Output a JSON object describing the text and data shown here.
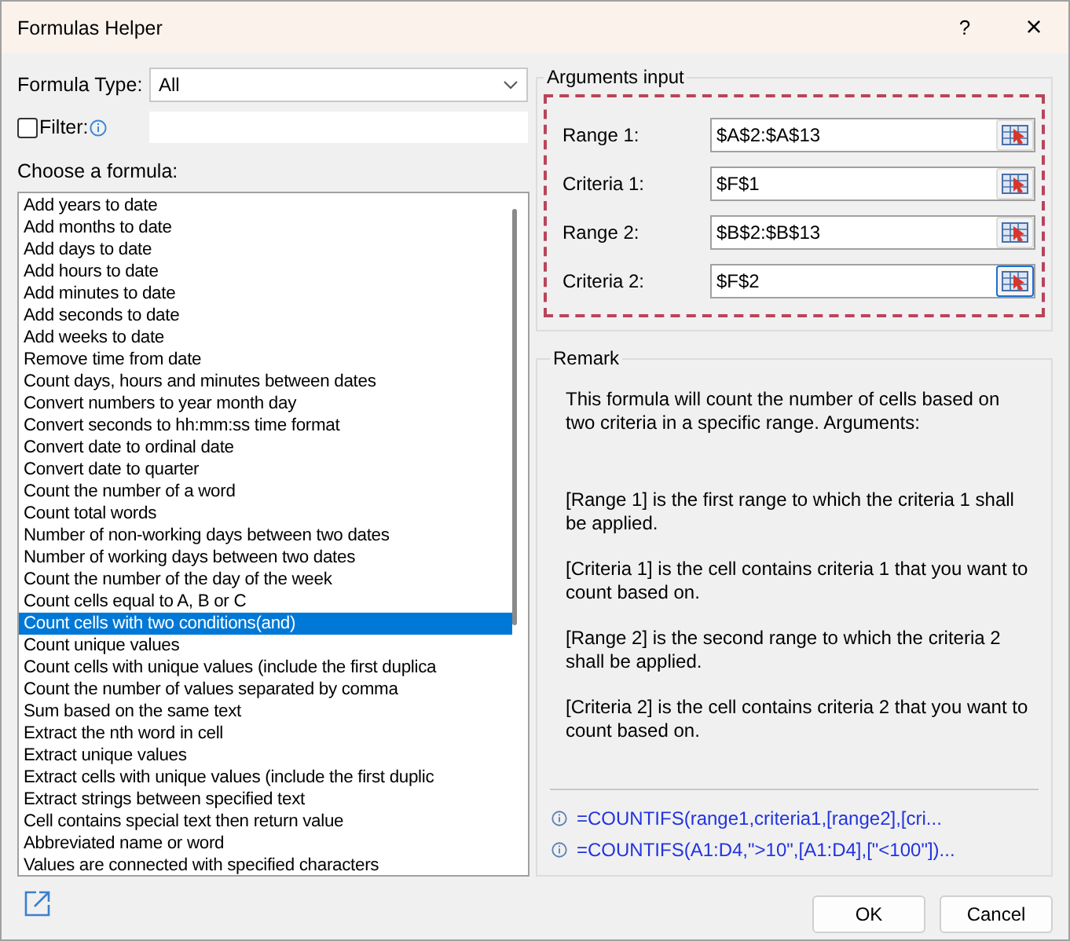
{
  "window": {
    "title": "Formulas Helper",
    "help": "?",
    "close": "×"
  },
  "formula_type": {
    "label": "Formula Type:",
    "value": "All"
  },
  "filter": {
    "label": "Filter:",
    "checked": false
  },
  "list": {
    "label": "Choose a formula:",
    "items": [
      {
        "text": "Add years to date",
        "selected": false
      },
      {
        "text": "Add months to date",
        "selected": false
      },
      {
        "text": "Add days to date",
        "selected": false
      },
      {
        "text": "Add hours to date",
        "selected": false
      },
      {
        "text": "Add minutes to date",
        "selected": false
      },
      {
        "text": "Add seconds to date",
        "selected": false
      },
      {
        "text": "Add weeks to date",
        "selected": false
      },
      {
        "text": "Remove time from date",
        "selected": false
      },
      {
        "text": "Count days, hours and minutes between dates",
        "selected": false
      },
      {
        "text": "Convert numbers to year month day",
        "selected": false
      },
      {
        "text": "Convert seconds to hh:mm:ss time format",
        "selected": false
      },
      {
        "text": "Convert date to ordinal date",
        "selected": false
      },
      {
        "text": "Convert date to quarter",
        "selected": false
      },
      {
        "text": "Count the number of a word",
        "selected": false
      },
      {
        "text": "Count total words",
        "selected": false
      },
      {
        "text": "Number of non-working days between two dates",
        "selected": false
      },
      {
        "text": "Number of working days between two dates",
        "selected": false
      },
      {
        "text": "Count the number of the day of the week",
        "selected": false
      },
      {
        "text": "Count cells equal to A, B or C",
        "selected": false
      },
      {
        "text": "Count cells with two conditions(and)",
        "selected": true
      },
      {
        "text": "Count unique values",
        "selected": false
      },
      {
        "text": "Count cells with unique values (include the first duplica",
        "selected": false
      },
      {
        "text": "Count the number of values separated by comma",
        "selected": false
      },
      {
        "text": "Sum based on the same text",
        "selected": false
      },
      {
        "text": "Extract the nth word in cell",
        "selected": false
      },
      {
        "text": "Extract unique values",
        "selected": false
      },
      {
        "text": "Extract cells with unique values (include the first duplic",
        "selected": false
      },
      {
        "text": "Extract strings between specified text",
        "selected": false
      },
      {
        "text": "Cell contains special text then return value",
        "selected": false
      },
      {
        "text": "Abbreviated name or word",
        "selected": false
      },
      {
        "text": "Values are connected with specified characters",
        "selected": false
      }
    ]
  },
  "arguments": {
    "title": "Arguments input",
    "fields": [
      {
        "label": "Range 1:",
        "value": "$A$2:$A$13",
        "focused": false
      },
      {
        "label": "Criteria 1:",
        "value": "$F$1",
        "focused": false
      },
      {
        "label": "Range 2:",
        "value": "$B$2:$B$13",
        "focused": false
      },
      {
        "label": "Criteria 2:",
        "value": "$F$2",
        "focused": true
      }
    ]
  },
  "remark": {
    "title": "Remark",
    "paragraphs": [
      "This formula will count the number of cells based on two criteria in a specific range. Arguments:",
      "[Range 1] is the first range to which the criteria 1 shall be applied.",
      "[Criteria 1] is the cell contains criteria 1 that you want to count based on.",
      "[Range 2] is the second range to which the criteria 2 shall be applied.",
      "[Criteria 2] is the cell contains criteria 2 that you want to count based on."
    ],
    "formulas": [
      "=COUNTIFS(range1,criteria1,[range2],[cri...",
      "=COUNTIFS(A1:D4,\">10\",[A1:D4],[\"<100\"])..."
    ]
  },
  "buttons": [
    "OK",
    "Cancel"
  ]
}
